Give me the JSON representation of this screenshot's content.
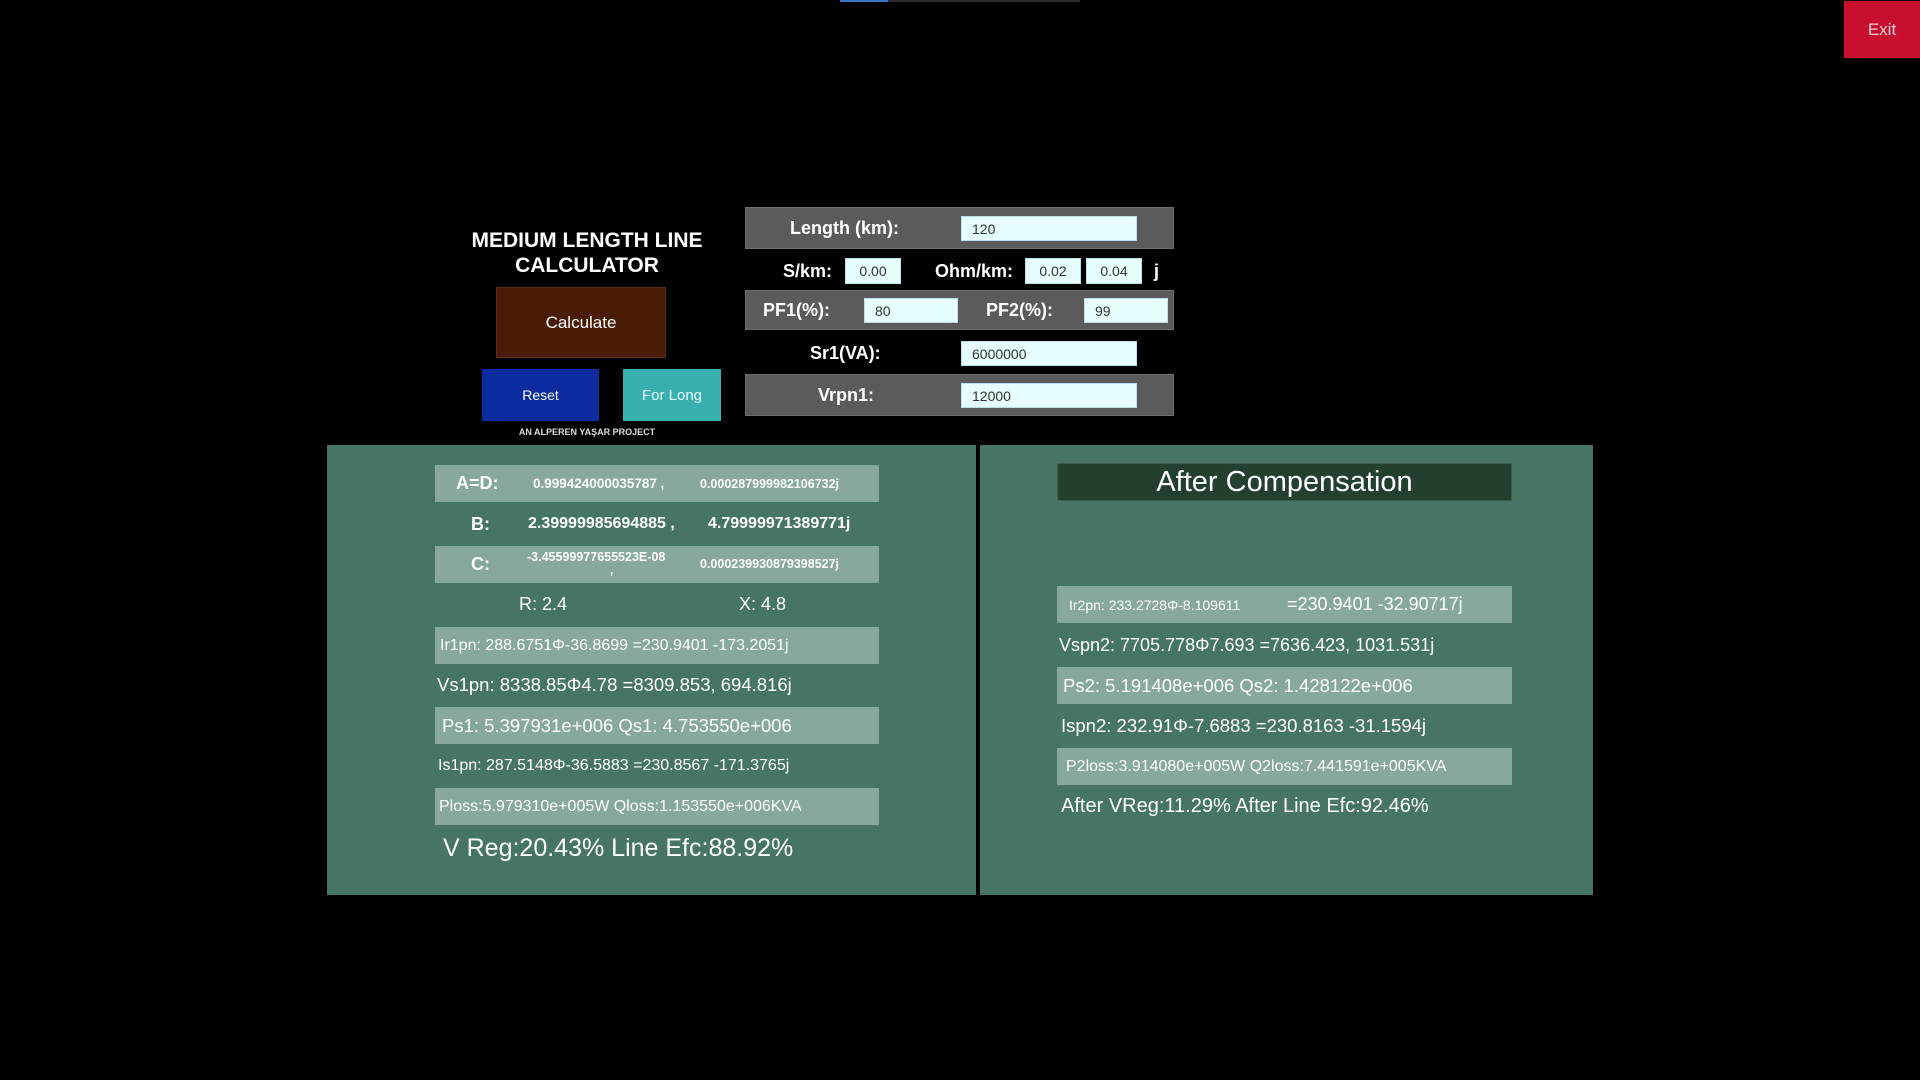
{
  "window": {
    "exit_label": "Exit"
  },
  "header": {
    "title": "MEDIUM LENGTH LINE CALCULATOR",
    "calculate_label": "Calculate",
    "reset_label": "Reset",
    "for_long_label": "For Long",
    "credit": "AN ALPEREN YAŞAR PROJECT"
  },
  "inputs": {
    "length_label": "Length (km):",
    "length_value": "120",
    "s_km_label": "S/km:",
    "s_km_value": "0.00",
    "ohm_km_label": "Ohm/km:",
    "ohm_real": "0.02",
    "ohm_imag": "0.04",
    "j_label": "j",
    "pf1_label": "PF1(%):",
    "pf1_value": "80",
    "pf2_label": "PF2(%):",
    "pf2_value": "99",
    "sr1_label": "Sr1(VA):",
    "sr1_value": "6000000",
    "vrpn1_label": "Vrpn1:",
    "vrpn1_value": "12000"
  },
  "results": {
    "ad_label": "A=D:",
    "ad_real": "0.999424000035787 ,",
    "ad_imag": "0.000287999982106732j",
    "b_label": "B:",
    "b_real": "2.39999985694885 ,",
    "b_imag": "4.79999971389771j",
    "c_label": "C:",
    "c_real": "-3.45599977655523E-08",
    "c_comma": ",",
    "c_imag": "0.000239930879398527j",
    "r_text": "R: 2.4",
    "x_text": "X: 4.8",
    "ir1pn": "Ir1pn: 288.6751Φ-36.8699 =230.9401  -173.2051j",
    "vs1pn": "Vs1pn: 8338.85Φ4.78 =8309.853, 694.816j",
    "ps1qs1": "Ps1: 5.397931e+006  Qs1: 4.753550e+006",
    "is1pn": "Is1pn: 287.5148Φ-36.5883  =230.8567  -171.3765j",
    "loss": "Ploss:5.979310e+005W Qloss:1.153550e+006KVA",
    "vreg": "V Reg:20.43% Line Efc:88.92%"
  },
  "compensation": {
    "title": "After Compensation",
    "ir2pn_left": "Ir2pn: 233.2728Φ-8.109611",
    "ir2pn_right": "=230.9401  -32.90717j",
    "vspn2": "Vspn2: 7705.778Φ7.693  =7636.423, 1031.531j",
    "ps2qs2": "Ps2: 5.191408e+006  Qs2: 1.428122e+006",
    "ispn2": "Ispn2: 232.91Φ-7.6883 =230.8163  -31.1594j",
    "loss2": "P2loss:3.914080e+005W  Q2loss:7.441591e+005KVA",
    "vreg2": "After VReg:11.29% After Line Efc:92.46%"
  }
}
